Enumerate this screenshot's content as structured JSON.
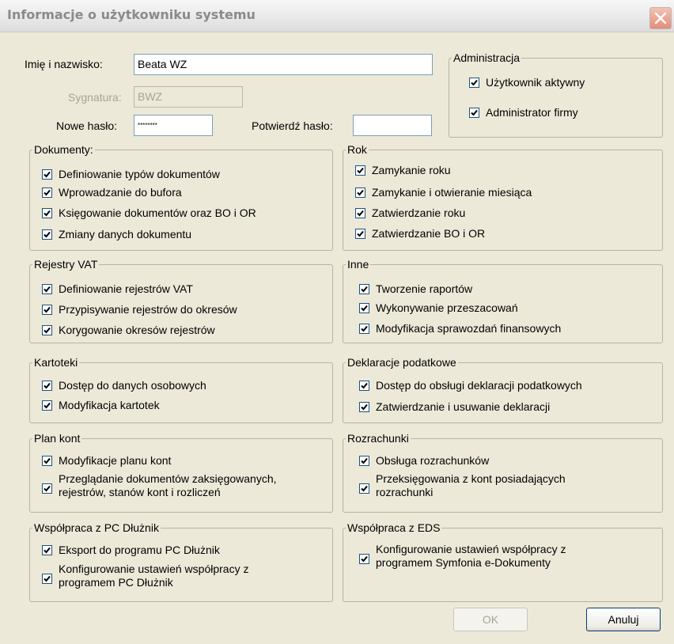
{
  "window": {
    "title": "Informacje o użytkowniku systemu"
  },
  "user": {
    "name_label": "Imię i nazwisko:",
    "name_value": "Beata WZ",
    "signature_label": "Sygnatura:",
    "signature_value": "BWZ",
    "password_label": "Nowe hasło:",
    "password_value": "********",
    "confirm_label": "Potwierdź hasło:",
    "confirm_value": ""
  },
  "groups": {
    "admin": {
      "legend": "Administracja",
      "items": [
        {
          "label": "Użytkownik aktywny",
          "checked": true
        },
        {
          "label": "Administrator firmy",
          "checked": true
        }
      ]
    },
    "dokumenty": {
      "legend": "Dokumenty:",
      "items": [
        {
          "label": "Definiowanie typów dokumentów",
          "checked": true
        },
        {
          "label": "Wprowadzanie do bufora",
          "checked": true
        },
        {
          "label": "Księgowanie dokumentów oraz BO i OR",
          "checked": true
        },
        {
          "label": "Zmiany danych dokumentu",
          "checked": true
        }
      ]
    },
    "rok": {
      "legend": "Rok",
      "items": [
        {
          "label": "Zamykanie roku",
          "checked": true
        },
        {
          "label": "Zamykanie i otwieranie miesiąca",
          "checked": true
        },
        {
          "label": "Zatwierdzanie roku",
          "checked": true
        },
        {
          "label": "Zatwierdzanie BO i OR",
          "checked": true
        }
      ]
    },
    "vat": {
      "legend": "Rejestry VAT",
      "items": [
        {
          "label": "Definiowanie rejestrów VAT",
          "checked": true
        },
        {
          "label": "Przypisywanie rejestrów do okresów",
          "checked": true
        },
        {
          "label": "Korygowanie okresów rejestrów",
          "checked": true
        }
      ]
    },
    "inne": {
      "legend": "Inne",
      "items": [
        {
          "label": "Tworzenie raportów",
          "checked": true
        },
        {
          "label": "Wykonywanie przeszacowań",
          "checked": true
        },
        {
          "label": "Modyfikacja sprawozdań finansowych",
          "checked": true
        }
      ]
    },
    "kartoteki": {
      "legend": "Kartoteki",
      "items": [
        {
          "label": "Dostęp do danych osobowych",
          "checked": true
        },
        {
          "label": "Modyfikacja kartotek",
          "checked": true
        }
      ]
    },
    "deklaracje": {
      "legend": "Deklaracje podatkowe",
      "items": [
        {
          "label": "Dostęp do obsługi deklaracji podatkowych",
          "checked": true
        },
        {
          "label": "Zatwierdzanie i usuwanie deklaracji",
          "checked": true
        }
      ]
    },
    "plan": {
      "legend": "Plan kont",
      "items": [
        {
          "label": "Modyfikacje planu kont",
          "checked": true
        },
        {
          "label_line1": "Przeglądanie dokumentów zaksięgowanych,",
          "label_line2": "rejestrów, stanów kont i rozliczeń",
          "checked": true
        }
      ]
    },
    "rozrachunki": {
      "legend": "Rozrachunki",
      "items": [
        {
          "label": "Obsługa rozrachunków",
          "checked": true
        },
        {
          "label_line1": "Przeksięgowania z kont posiadających",
          "label_line2": "rozrachunki",
          "checked": true
        }
      ]
    },
    "pcd": {
      "legend": "Współpraca z PC Dłużnik",
      "items": [
        {
          "label": "Eksport do programu PC Dłużnik",
          "checked": true
        },
        {
          "label_line1": "Konfigurowanie ustawień współpracy z",
          "label_line2": "programem PC Dłużnik",
          "checked": true
        }
      ]
    },
    "eds": {
      "legend": "Współpraca z EDS",
      "items": [
        {
          "label_line1": "Konfigurowanie ustawień współpracy z",
          "label_line2": "programem Symfonia e-Dokumenty",
          "checked": true
        }
      ]
    }
  },
  "buttons": {
    "ok_label": "OK",
    "ok_disabled": true,
    "cancel_label": "Anuluj"
  }
}
